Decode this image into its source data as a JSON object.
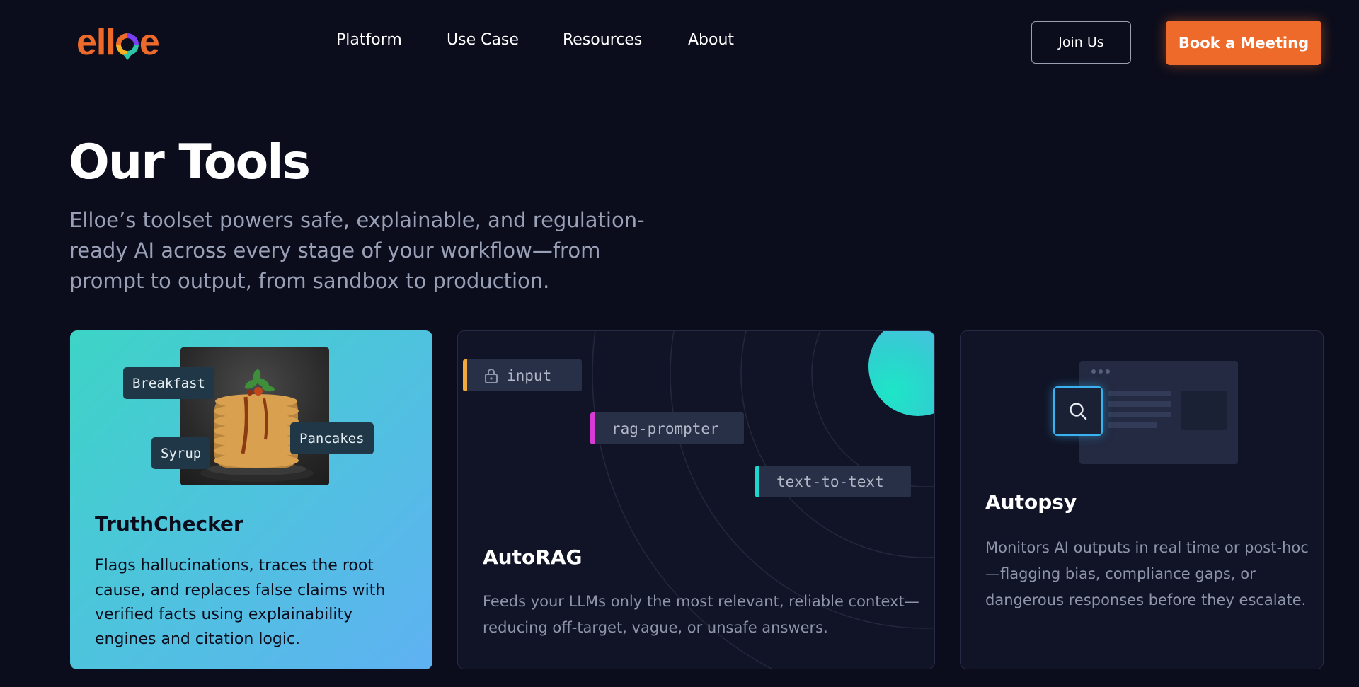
{
  "brand": {
    "name": "elloe",
    "accent": "#ee6a2b"
  },
  "nav": {
    "items": [
      {
        "label": "Platform"
      },
      {
        "label": "Use Case"
      },
      {
        "label": "Resources"
      },
      {
        "label": "About"
      }
    ]
  },
  "header": {
    "join_label": "Join Us",
    "book_label": "Book a Meeting"
  },
  "hero": {
    "title": "Our Tools",
    "subtitle": "Elloe’s toolset powers safe, explainable, and regulation-ready AI across every stage of your workflow—from prompt to output, from sandbox to production."
  },
  "cards": [
    {
      "title": "TruthChecker",
      "description": "Flags hallucinations, traces the root cause, and replaces false claims with verified facts using explainability engines and citation logic.",
      "tags": [
        "Breakfast",
        "Pancakes",
        "Syrup"
      ]
    },
    {
      "title": "AutoRAG",
      "description": "Feeds your LLMs only the most relevant, reliable context—reducing off-target, vague, or unsafe answers.",
      "pills": [
        "input",
        "rag-prompter",
        "text-to-text"
      ]
    },
    {
      "title": "Autopsy",
      "description": "Monitors AI outputs in real time or post-hoc—flagging bias, compliance gaps, or dangerous responses before they escalate."
    }
  ],
  "icons": {
    "logo": "elloe-logo",
    "lock": "lock-icon",
    "search": "search-icon"
  }
}
